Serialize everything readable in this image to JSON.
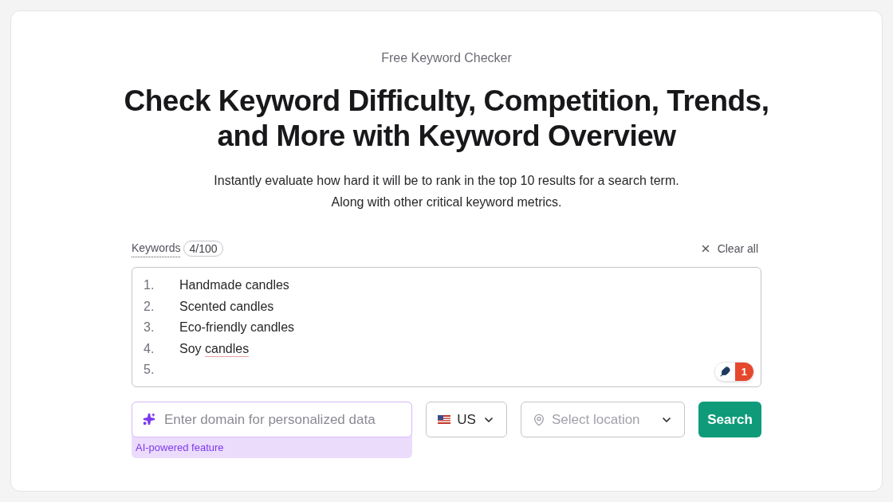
{
  "eyebrow": "Free Keyword Checker",
  "heading": "Check Keyword Difficulty, Competition, Trends, and More with Keyword Overview",
  "description": "Instantly evaluate how hard it will be to rank in the top 10 results for a search term. Along with other critical keyword metrics.",
  "keywords": {
    "label": "Keywords",
    "count": "4/100",
    "clear": "Clear all",
    "items": [
      {
        "number": "1.",
        "text": "Handmade candles",
        "flagged": false
      },
      {
        "number": "2.",
        "text": "Scented candles",
        "flagged": false
      },
      {
        "number": "3.",
        "text": "Eco-friendly candles",
        "flagged": false
      },
      {
        "number": "4.",
        "text": "Soy candles",
        "flagged": true
      },
      {
        "number": "5.",
        "flagged": false
      }
    ],
    "assistant_badge": "1"
  },
  "domain": {
    "placeholder": "Enter domain for personalized data",
    "note": "AI-powered feature"
  },
  "country": {
    "value": "US"
  },
  "location": {
    "placeholder": "Select location"
  },
  "search_button": "Search"
}
